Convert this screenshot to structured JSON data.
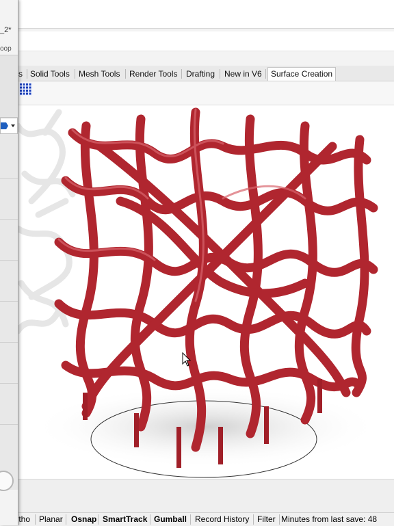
{
  "left_window": {
    "title_fragment": "_2*",
    "subtitle_fragment": "oop"
  },
  "tabs": [
    {
      "label": "s"
    },
    {
      "label": "Solid Tools"
    },
    {
      "label": "Mesh Tools"
    },
    {
      "label": "Render Tools"
    },
    {
      "label": "Drafting"
    },
    {
      "label": "New in V6"
    },
    {
      "label": "Surface Creation"
    }
  ],
  "active_tab": "Surface Creation",
  "viewport": {
    "object_color": "#b0262f",
    "shadow_color": "#d8d8d8"
  },
  "status_bar": {
    "items": [
      {
        "label": "Ortho",
        "bold": false
      },
      {
        "label": "Planar",
        "bold": false
      },
      {
        "label": "Osnap",
        "bold": true
      },
      {
        "label": "SmartTrack",
        "bold": true
      },
      {
        "label": "Gumball",
        "bold": true
      },
      {
        "label": "Record History",
        "bold": false
      },
      {
        "label": "Filter",
        "bold": false
      },
      {
        "label": "Minutes from last save: 48",
        "bold": false
      }
    ]
  }
}
